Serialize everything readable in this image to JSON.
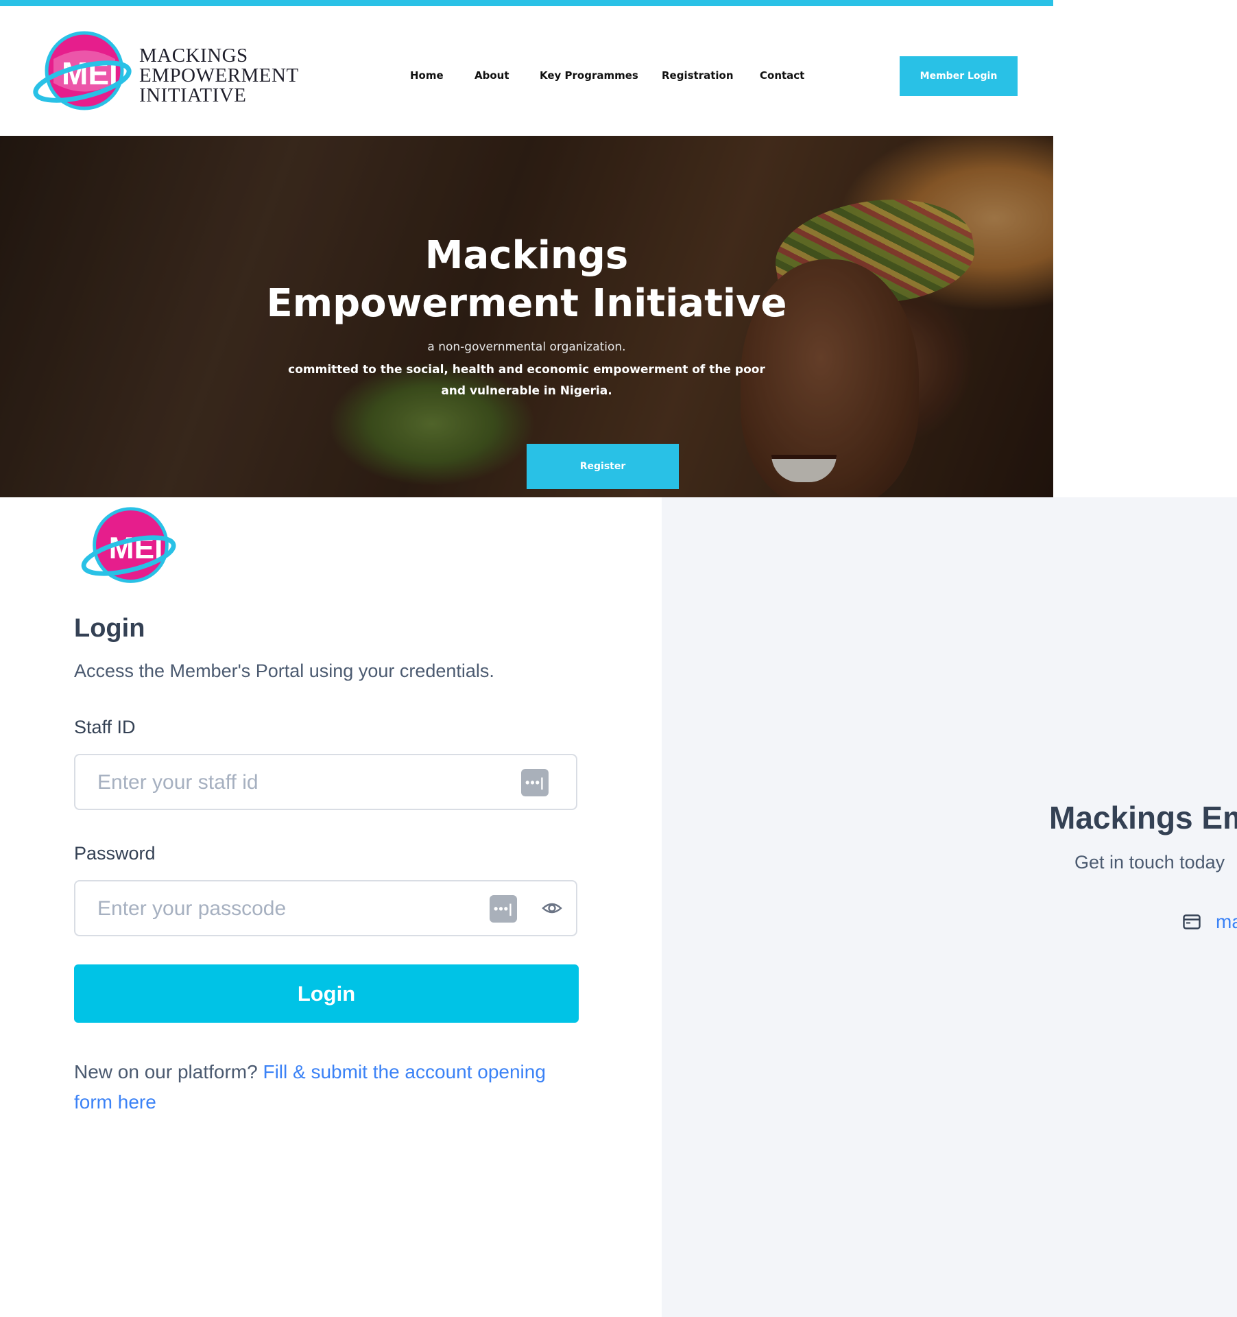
{
  "brand": {
    "logo_lines": [
      "MACKINGS",
      "EMPOWERMENT",
      "INITIATIVE"
    ],
    "logo_monogram": "MEI",
    "accent_color": "#29c1e6"
  },
  "nav": {
    "items": [
      "Home",
      "About",
      "Key Programmes",
      "Registration",
      "Contact"
    ],
    "member_login": "Member Login"
  },
  "hero": {
    "title_line1": "Mackings",
    "title_line2": "Empowerment Initiative",
    "subtitle": "a non-governmental organization.",
    "description": "committed to the social, health and economic empowerment of the poor and vulnerable in Nigeria.",
    "register_label": "Register"
  },
  "login": {
    "title": "Login",
    "description": "Access the Member's Portal using your credentials.",
    "staff_label": "Staff ID",
    "staff_placeholder": "Enter your staff id",
    "password_label": "Password",
    "password_placeholder": "Enter your passcode",
    "submit_label": "Login",
    "signup_prompt": "New on our platform?",
    "signup_link": "Fill & submit the account opening form here",
    "password_manager_icon": "•••|",
    "button_color": "#00c3e6"
  },
  "contact": {
    "title": "Mackings Em",
    "subtitle": "Get in touch today",
    "email_partial": "ma",
    "icon": "mail-icon"
  }
}
